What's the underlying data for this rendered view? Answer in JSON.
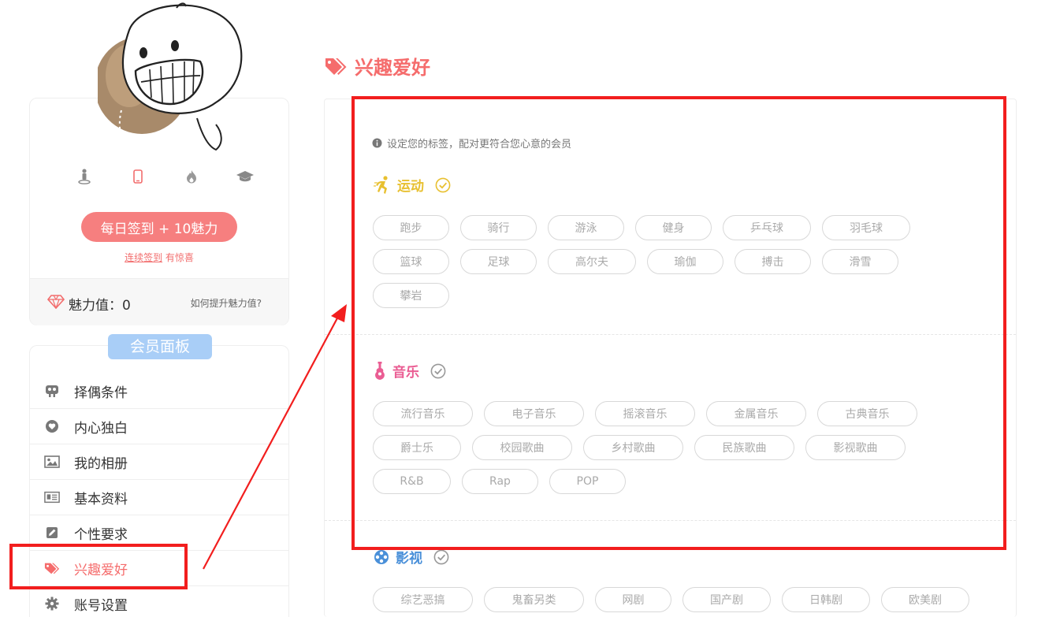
{
  "profile": {
    "signin_button": "每日签到 + 10魅力",
    "signin_link": "连续签到",
    "signin_suffix": "有惊喜",
    "charm_label": "魅力值：0",
    "charm_help": "如何提升魅力值?"
  },
  "menu": {
    "title": "会员面板",
    "items": [
      {
        "label": "择偶条件",
        "icon": "couple-icon"
      },
      {
        "label": "内心独白",
        "icon": "heart-icon"
      },
      {
        "label": "我的相册",
        "icon": "image-icon"
      },
      {
        "label": "基本资料",
        "icon": "id-card-icon"
      },
      {
        "label": "个性要求",
        "icon": "edit-icon"
      },
      {
        "label": "兴趣爱好",
        "icon": "tags-icon",
        "active": true
      },
      {
        "label": "账号设置",
        "icon": "gear-icon"
      }
    ]
  },
  "page": {
    "title": "兴趣爱好",
    "hint": "设定您的标签，配对更符合您心意的会员"
  },
  "sections": [
    {
      "title": "运动",
      "color": "#e8c030",
      "rows": [
        [
          "跑步",
          "骑行",
          "游泳",
          "健身",
          "乒乓球",
          "羽毛球"
        ],
        [
          "篮球",
          "足球",
          "高尔夫",
          "瑜伽",
          "搏击",
          "滑雪"
        ],
        [
          "攀岩"
        ]
      ]
    },
    {
      "title": "音乐",
      "color": "#ea5d93",
      "rows": [
        [
          "流行音乐",
          "电子音乐",
          "摇滚音乐",
          "金属音乐",
          "古典音乐"
        ],
        [
          "爵士乐",
          "校园歌曲",
          "乡村歌曲",
          "民族歌曲",
          "影视歌曲"
        ],
        [
          "R&B",
          "Rap",
          "POP"
        ]
      ]
    },
    {
      "title": "影视",
      "color": "#4a90d9",
      "rows": [
        [
          "综艺恶搞",
          "鬼畜另类",
          "网剧",
          "国产剧",
          "日韩剧",
          "欧美剧"
        ]
      ]
    }
  ],
  "colors": {
    "accent": "#f56c6c",
    "signin": "#f67f7f",
    "panel_title": "#a9cef7",
    "annotation": "#f21e1e"
  }
}
